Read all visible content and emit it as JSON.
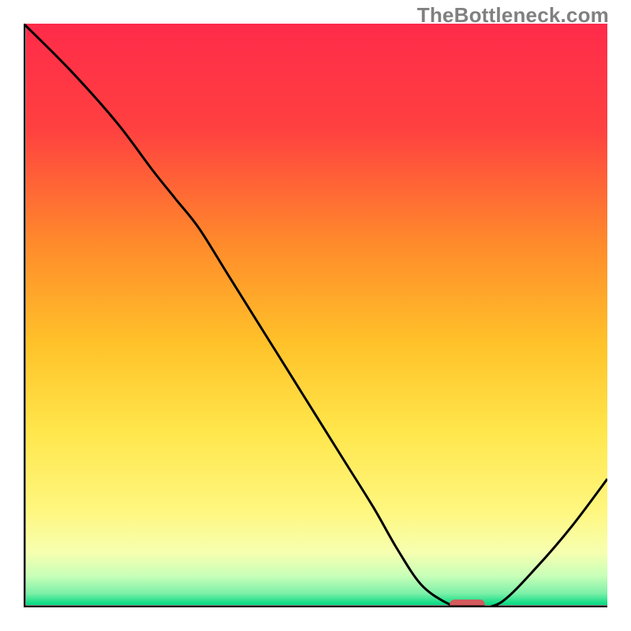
{
  "watermark": "TheBottleneck.com",
  "chart_data": {
    "type": "line",
    "title": "",
    "xlabel": "",
    "ylabel": "",
    "xlim": [
      0,
      100
    ],
    "ylim": [
      0,
      100
    ],
    "series": [
      {
        "name": "curve",
        "x": [
          0,
          8,
          16,
          22,
          26,
          30,
          35,
          40,
          45,
          50,
          55,
          60,
          64,
          68,
          72,
          75,
          78,
          82,
          88,
          94,
          100
        ],
        "y": [
          100,
          92,
          83,
          75,
          70,
          65,
          57,
          49,
          41,
          33,
          25,
          17,
          10,
          4,
          1,
          0,
          0,
          1,
          7,
          14,
          22
        ]
      }
    ],
    "marker": {
      "x": 76,
      "y": 0,
      "width": 6,
      "height": 1.6
    },
    "gradient_stops": [
      {
        "offset": 0,
        "color": "#ff2b4a"
      },
      {
        "offset": 18,
        "color": "#ff4040"
      },
      {
        "offset": 38,
        "color": "#ff8b2b"
      },
      {
        "offset": 55,
        "color": "#ffc229"
      },
      {
        "offset": 70,
        "color": "#ffe64b"
      },
      {
        "offset": 84,
        "color": "#fff780"
      },
      {
        "offset": 91,
        "color": "#f6ffb0"
      },
      {
        "offset": 95,
        "color": "#c8ffb8"
      },
      {
        "offset": 98,
        "color": "#7df0a8"
      },
      {
        "offset": 100,
        "color": "#00d980"
      }
    ],
    "axis_color": "#000000",
    "line_color": "#000000",
    "marker_color": "#d45a5d"
  }
}
